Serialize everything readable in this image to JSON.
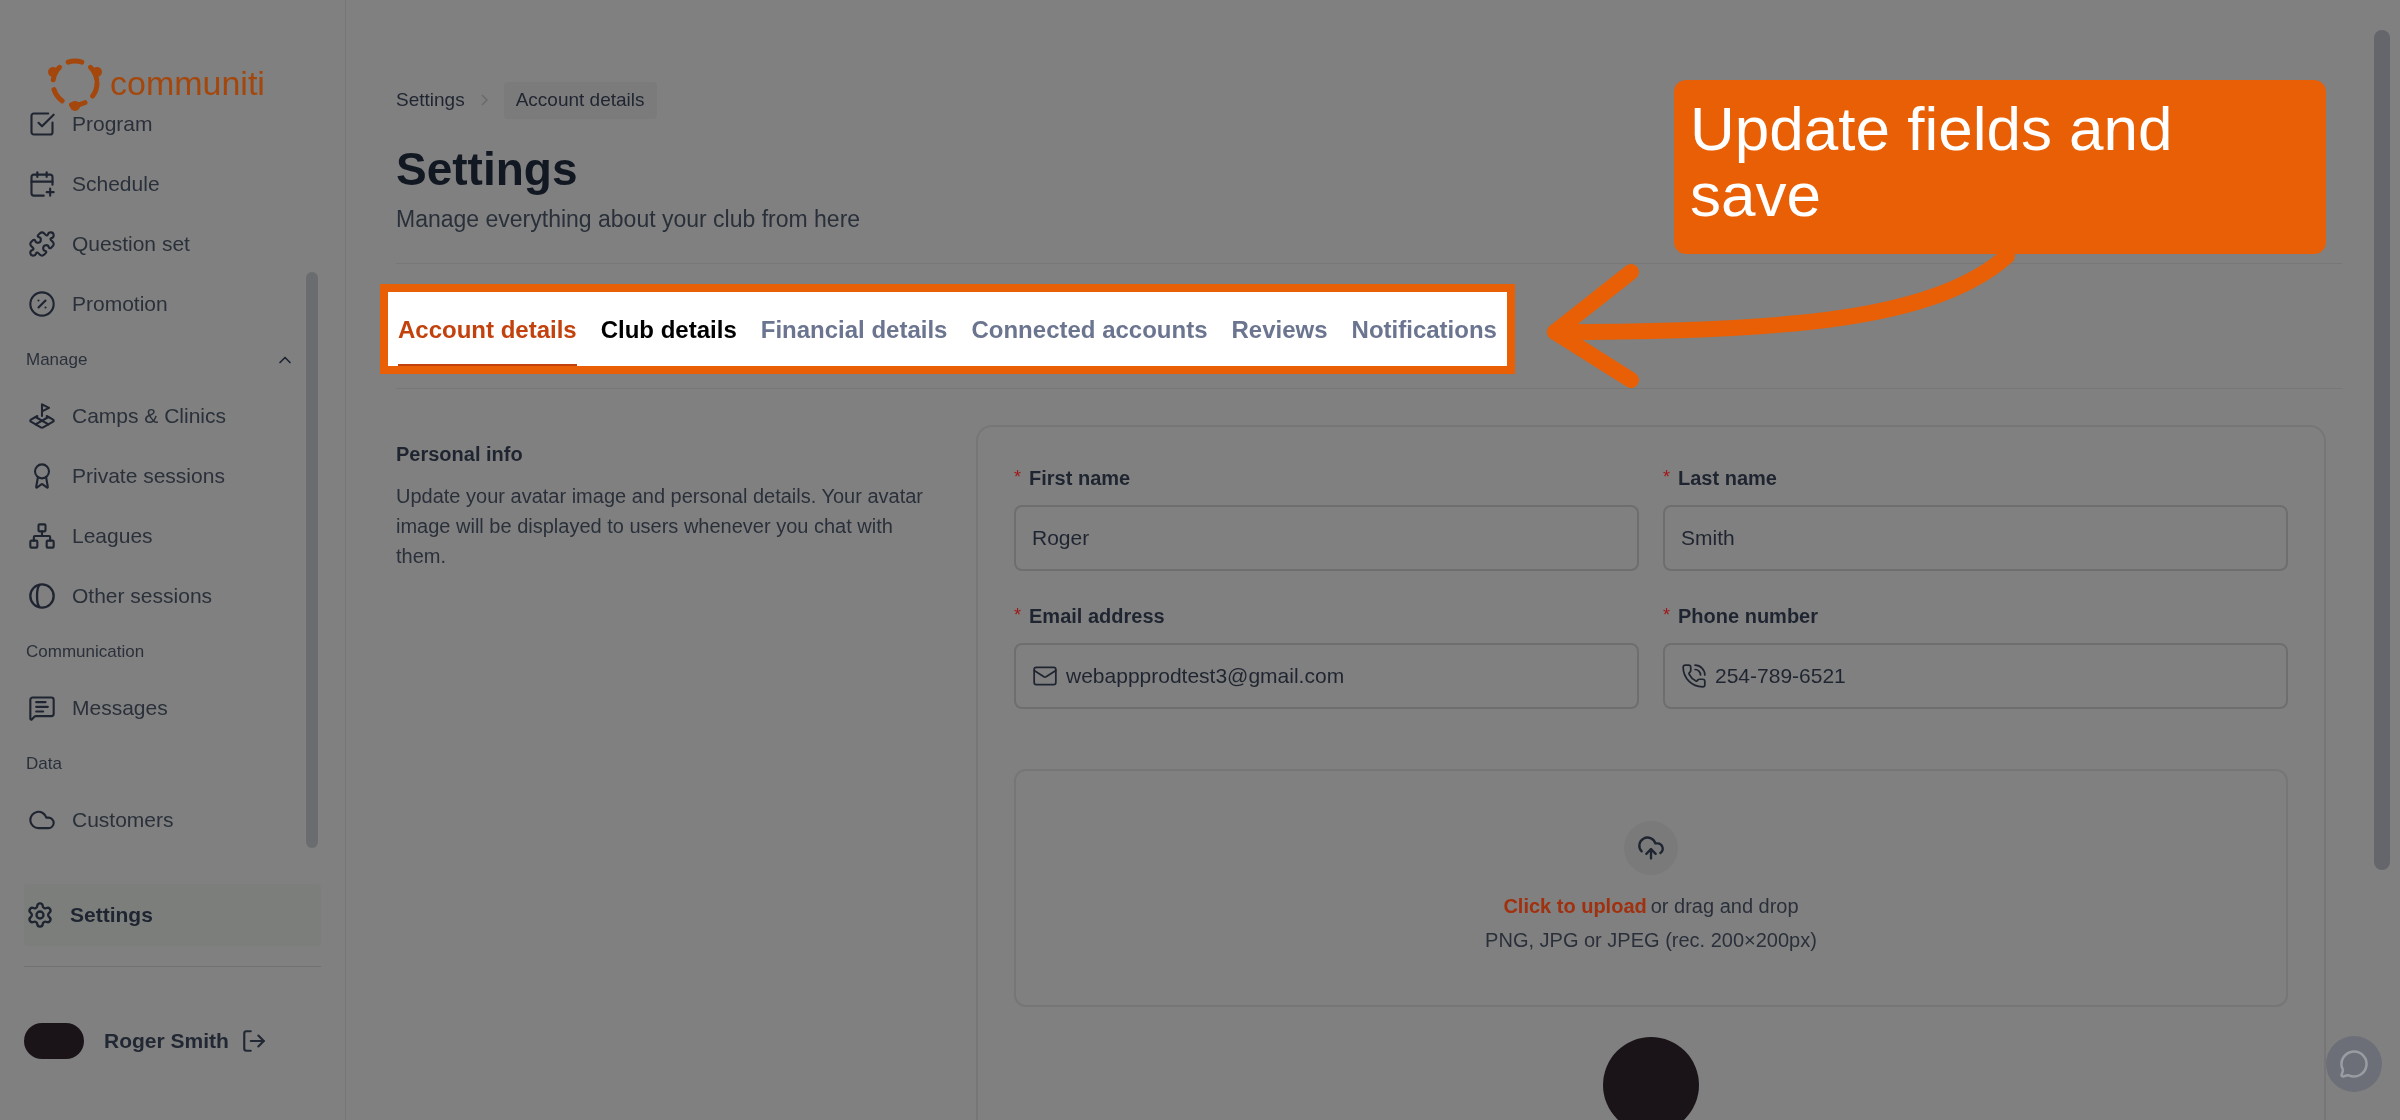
{
  "logo": {
    "text": "communiti"
  },
  "sidebar": {
    "items": [
      {
        "kind": "item",
        "label": "Program",
        "selected": false
      },
      {
        "kind": "item",
        "label": "Schedule",
        "selected": false
      },
      {
        "kind": "item",
        "label": "Question set",
        "selected": false
      },
      {
        "kind": "item",
        "label": "Promotion",
        "selected": false
      },
      {
        "kind": "section",
        "label": "Manage",
        "expanded": true
      },
      {
        "kind": "item",
        "label": "Camps & Clinics",
        "selected": false
      },
      {
        "kind": "item",
        "label": "Private sessions",
        "selected": false
      },
      {
        "kind": "item",
        "label": "Leagues",
        "selected": false
      },
      {
        "kind": "item",
        "label": "Other sessions",
        "selected": false
      },
      {
        "kind": "section",
        "label": "Communication"
      },
      {
        "kind": "item",
        "label": "Messages",
        "selected": false
      },
      {
        "kind": "section",
        "label": "Data"
      },
      {
        "kind": "item",
        "label": "Customers",
        "selected": false
      }
    ],
    "settings": {
      "label": "Settings",
      "selected": true
    },
    "user": {
      "name": "Roger Smith"
    }
  },
  "breadcrumb": [
    "Settings",
    "Account details"
  ],
  "title": "Settings",
  "subtitle": "Manage everything about your club from here",
  "tabs": [
    {
      "label": "Account details",
      "selected": true,
      "hovered": false
    },
    {
      "label": "Club details",
      "selected": false,
      "hovered": true
    },
    {
      "label": "Financial details",
      "selected": false,
      "hovered": false
    },
    {
      "label": "Connected accounts",
      "selected": false,
      "hovered": false
    },
    {
      "label": "Reviews",
      "selected": false,
      "hovered": false
    },
    {
      "label": "Notifications",
      "selected": false,
      "hovered": false
    }
  ],
  "personal_info": {
    "heading": "Personal info",
    "description": "Update your avatar image and personal details. Your avatar image will be displayed to users whenever you chat with them."
  },
  "fields": [
    {
      "kind": "text",
      "label": "First name",
      "required": true,
      "value": "Roger"
    },
    {
      "kind": "text",
      "label": "Last name",
      "required": true,
      "value": "Smith"
    },
    {
      "kind": "email",
      "label": "Email address",
      "required": true,
      "value": "webappprodtest3@gmail.com"
    },
    {
      "kind": "phone",
      "label": "Phone number",
      "required": true,
      "value": "254-789-6521"
    }
  ],
  "required_mark": "*",
  "upload": {
    "link": "Click to upload",
    "text": "or drag and drop",
    "hint": "PNG, JPG or JPEG (rec. 200×200px)"
  },
  "callout": {
    "text": "Update fields and save"
  }
}
